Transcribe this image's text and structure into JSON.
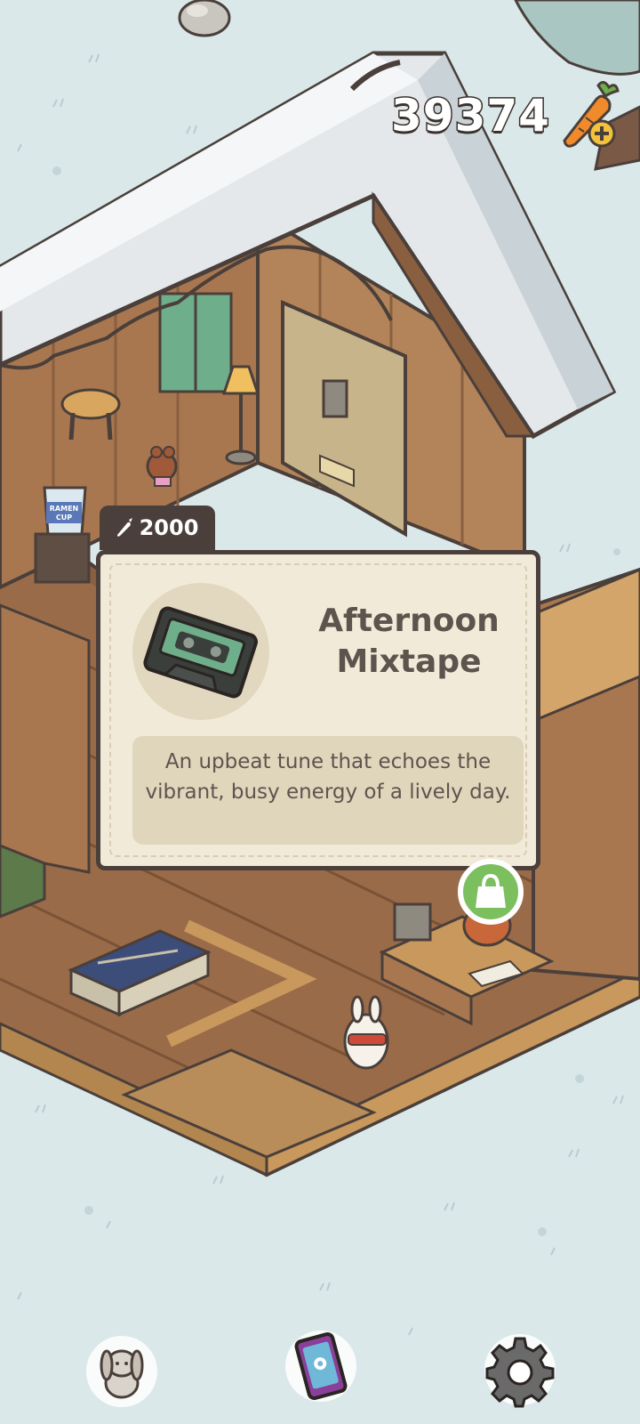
{
  "hud": {
    "carrot_count": "39374",
    "carrot_icon": "carrot-add-icon"
  },
  "item_popup": {
    "price": "2000",
    "price_icon": "carrot-icon",
    "name": "Afternoon Mixtape",
    "description": "An upbeat tune that echoes the vibrant, busy energy of a lively day.",
    "thumbnail_icon": "cassette-tape-icon"
  },
  "world": {
    "shop_bubble_icon": "shopping-bag-icon",
    "ramen_cup_label_1": "RAMEN",
    "ramen_cup_label_2": "CUP"
  },
  "nav": {
    "left_icon": "rabbit-profile-icon",
    "center_icon": "phone-map-icon",
    "right_icon": "settings-gear-icon"
  },
  "colors": {
    "background": "#dbe8ea",
    "card_background": "#f2ead8",
    "card_border": "#4a3f3a",
    "text": "#5e544e",
    "shop_green": "#7cbf5e"
  }
}
